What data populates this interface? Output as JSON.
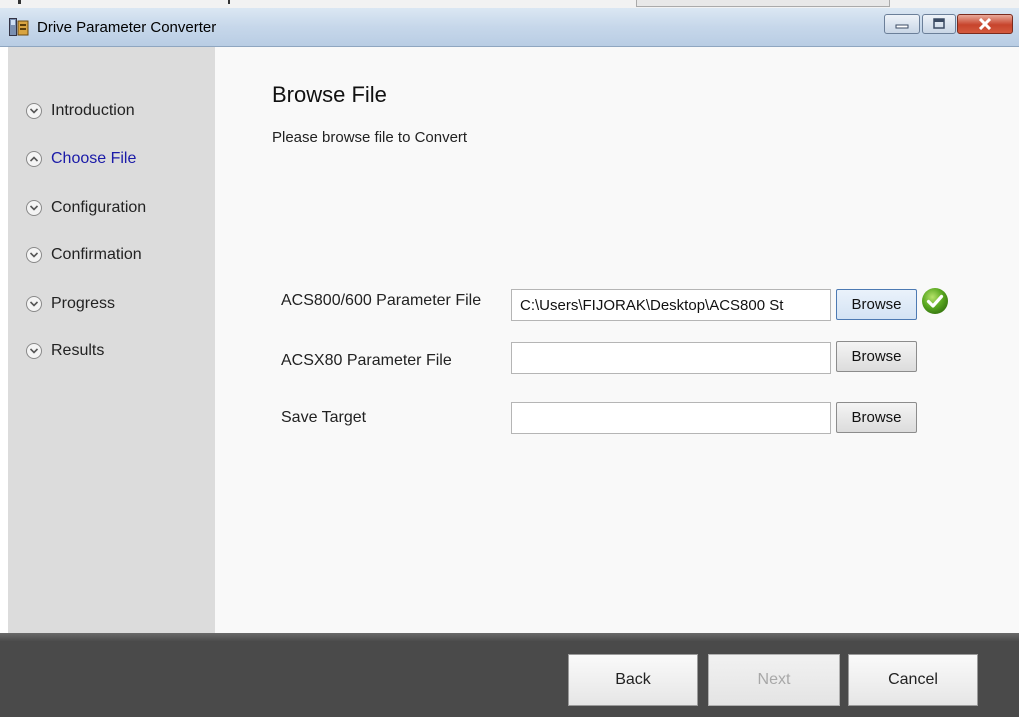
{
  "window": {
    "title": "Drive Parameter Converter",
    "icon": "drive-app-icon",
    "controls": [
      "minimize-icon",
      "maximize-icon",
      "close-icon"
    ]
  },
  "sidebar": {
    "items": [
      {
        "label": "Introduction",
        "icon": "chevron-down-icon",
        "active": false
      },
      {
        "label": "Choose File",
        "icon": "chevron-up-icon",
        "active": true
      },
      {
        "label": "Configuration",
        "icon": "chevron-down-icon",
        "active": false
      },
      {
        "label": "Confirmation",
        "icon": "chevron-down-icon",
        "active": false
      },
      {
        "label": "Progress",
        "icon": "chevron-down-icon",
        "active": false
      },
      {
        "label": "Results",
        "icon": "chevron-down-icon",
        "active": false
      }
    ],
    "active_color": "#1a1aa8"
  },
  "main": {
    "title": "Browse File",
    "subtitle": "Please browse file to Convert",
    "rows": [
      {
        "label": "ACS800/600 Parameter File",
        "value": "C:\\Users\\FIJORAK\\Desktop\\ACS800 St",
        "button": "Browse",
        "status": "check-icon"
      },
      {
        "label": "ACSX80 Parameter File",
        "value": "",
        "button": "Browse"
      },
      {
        "label": "Save Target",
        "value": "",
        "button": "Browse"
      }
    ]
  },
  "footer": {
    "back": "Back",
    "next": "Next",
    "cancel": "Cancel",
    "next_enabled": false
  }
}
